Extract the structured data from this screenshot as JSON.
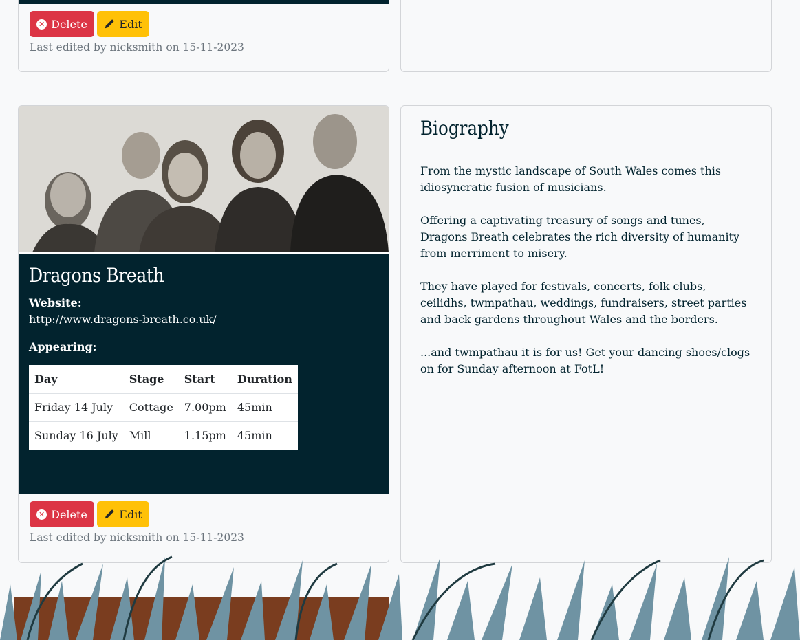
{
  "top_card": {
    "delete_label": "Delete",
    "edit_label": "Edit",
    "last_edited": "Last edited by nicksmith on 15-11-2023"
  },
  "artist_card": {
    "name": "Dragons Breath",
    "website_label": "Website:",
    "website_url": "http://www.dragons-breath.co.uk/",
    "appearing_label": "Appearing:",
    "table": {
      "headers": [
        "Day",
        "Stage",
        "Start",
        "Duration"
      ],
      "rows": [
        [
          "Friday 14 July",
          "Cottage",
          "7.00pm",
          "45min"
        ],
        [
          "Sunday 16 July",
          "Mill",
          "1.15pm",
          "45min"
        ]
      ]
    },
    "delete_label": "Delete",
    "edit_label": "Edit",
    "last_edited": "Last edited by nicksmith on 15-11-2023"
  },
  "biography": {
    "title": "Biography",
    "paragraphs": [
      "From the mystic landscape of South Wales comes this idiosyncratic fusion of musicians.",
      "Offering a captivating treasury of songs and tunes, Dragons Breath celebrates the rich diversity of humanity from merriment to misery.",
      "They have played for festivals, concerts, folk clubs, ceilidhs, twmpathau, weddings, fundraisers, street parties and back gardens throughout Wales and the borders.",
      "...and twmpathau it is for us! Get your dancing shoes/clogs on for Sunday afternoon at FotL!"
    ]
  },
  "colors": {
    "dark_teal": "#02232e",
    "delete_red": "#dc3545",
    "edit_yellow": "#ffc107",
    "muted_text": "#6c757d",
    "grass": "#6f93a3"
  },
  "icons": {
    "delete": "x-circle-icon",
    "edit": "pencil-icon"
  }
}
